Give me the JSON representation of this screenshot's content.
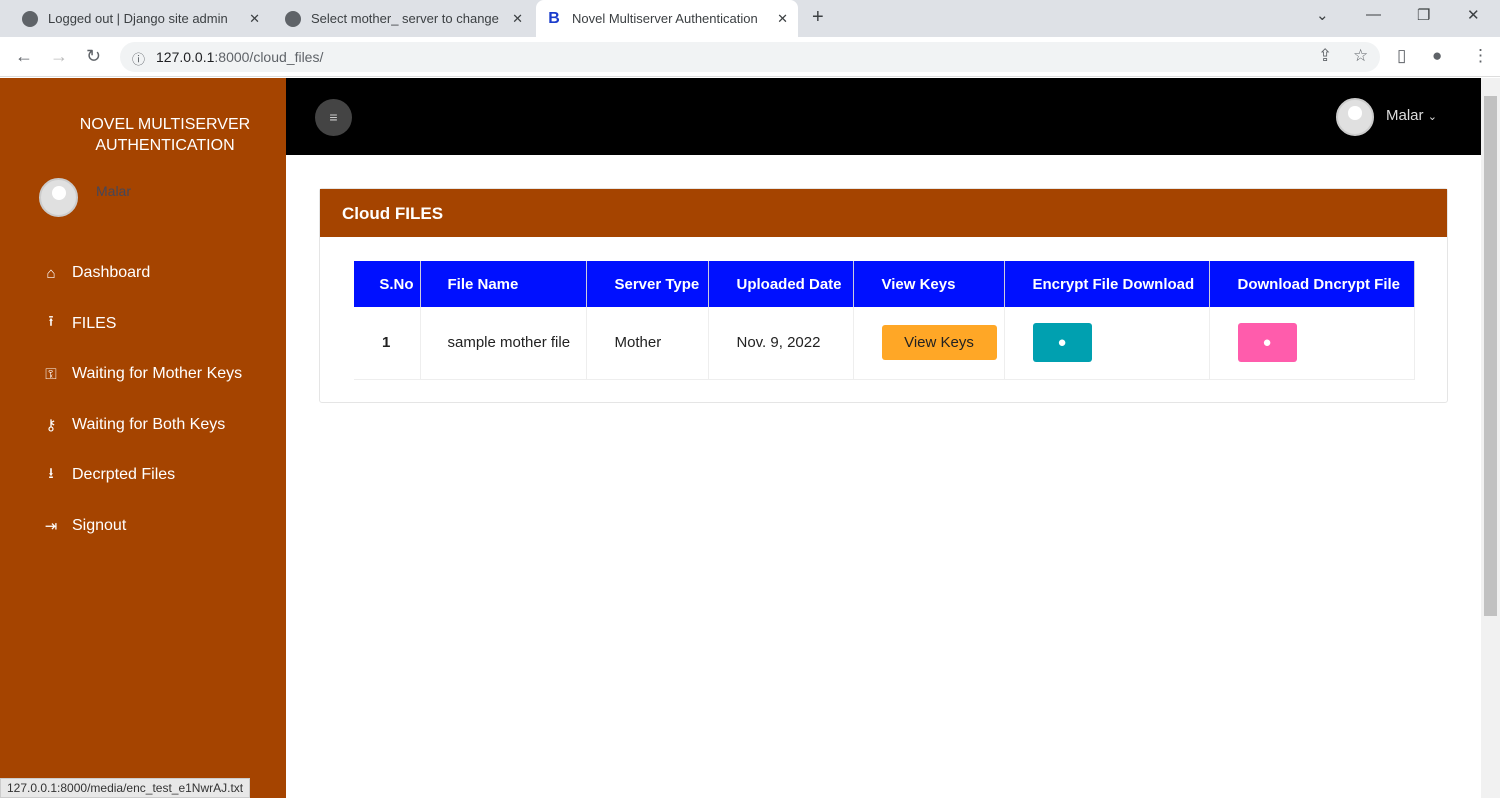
{
  "browser": {
    "tabs": [
      {
        "title": "Logged out | Django site admin"
      },
      {
        "title": "Select mother_ server to change"
      },
      {
        "title": "Novel Multiserver Authentication",
        "favicon": "B"
      }
    ],
    "url_host": "127.0.0.1",
    "url_rest": ":8000/cloud_files/",
    "status_url": "127.0.0.1:8000/media/enc_test_e1NwrAJ.txt"
  },
  "sidebar": {
    "brand": "NOVEL MULTISERVER AUTHENTICATION",
    "user": "Malar",
    "items": [
      {
        "label": "Dashboard",
        "icon": "home-icon"
      },
      {
        "label": "FILES",
        "icon": "upload-icon"
      },
      {
        "label": "Waiting for Mother Keys",
        "icon": "key-icon"
      },
      {
        "label": "Waiting for Both Keys",
        "icon": "key-plus-icon"
      },
      {
        "label": "Decrpted Files",
        "icon": "download-icon"
      },
      {
        "label": "Signout",
        "icon": "signout-icon"
      }
    ]
  },
  "topbar": {
    "user": "Malar"
  },
  "card": {
    "title": "Cloud FILES",
    "headers": [
      "S.No",
      "File Name",
      "Server Type",
      "Uploaded Date",
      "View Keys",
      "Encrypt File Download",
      "Download Dncrypt File"
    ],
    "rows": [
      {
        "sno": "1",
        "file_name": "sample mother file",
        "server_type": "Mother",
        "date": "Nov. 9, 2022",
        "view_keys": "View Keys"
      }
    ]
  },
  "colors": {
    "brand": "#a54400",
    "header": "#0010ff",
    "view_keys": "#ffa726",
    "encrypt": "#00a0b0",
    "decrypt": "#ff5cac"
  }
}
